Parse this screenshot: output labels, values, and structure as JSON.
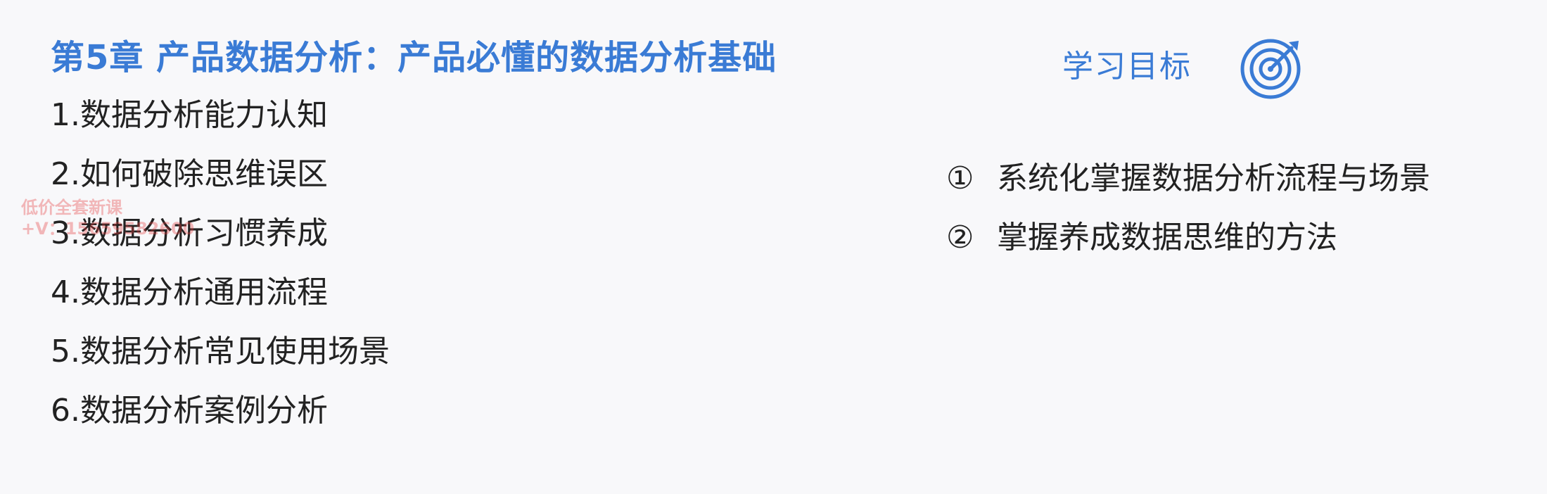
{
  "chapter_title": "第5章 产品数据分析：产品必懂的数据分析基础",
  "toc": [
    "1.数据分析能力认知",
    "2.如何破除思维误区",
    "3.数据分析习惯养成",
    "4.数据分析通用流程",
    "5.数据分析常见使用场景",
    "6.数据分析案例分析"
  ],
  "goals_header": "学习目标",
  "goals_icon": "target-icon",
  "goals": [
    {
      "num": "①",
      "text": "系统化掌握数据分析流程与场景"
    },
    {
      "num": "②",
      "text": "掌握养成数据思维的方法"
    }
  ],
  "watermark": {
    "line1": "低价全套新课",
    "line2": "+V：15659582600"
  },
  "colors": {
    "accent": "#3a7bd5",
    "text": "#222222",
    "background": "#f8f8fa"
  }
}
